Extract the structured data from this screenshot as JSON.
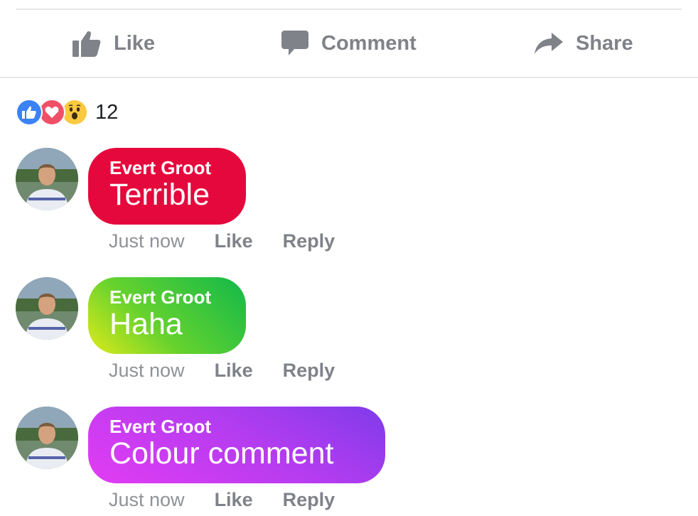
{
  "actions": {
    "like_label": "Like",
    "comment_label": "Comment",
    "share_label": "Share"
  },
  "reactions": {
    "types": [
      "like",
      "love",
      "wow"
    ],
    "count": "12"
  },
  "comments": [
    {
      "author": "Evert Groot",
      "text": "Terrible",
      "color": "#e5083c",
      "time": "Just now",
      "like_label": "Like",
      "reply_label": "Reply"
    },
    {
      "author": "Evert Groot",
      "text": "Haha",
      "color": "#66d22e",
      "time": "Just now",
      "like_label": "Like",
      "reply_label": "Reply"
    },
    {
      "author": "Evert Groot",
      "text": "Colour comment",
      "color": "#b53cf0",
      "time": "Just now",
      "like_label": "Like",
      "reply_label": "Reply"
    }
  ],
  "colors": {
    "accent_blue": "#3b82f6",
    "love_red": "#f05067",
    "wow_yellow": "#f9c940",
    "muted_text": "#7f8288"
  },
  "icons": {
    "like": "thumbs-up-icon",
    "comment": "comment-bubble-icon",
    "share": "share-arrow-icon"
  }
}
